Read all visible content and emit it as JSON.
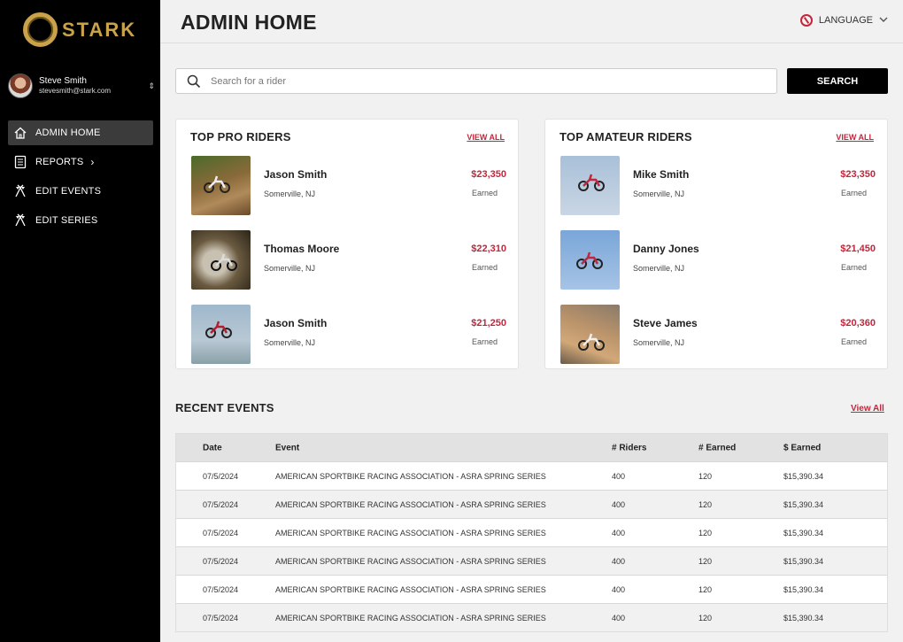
{
  "brand": {
    "name": "STARK"
  },
  "user": {
    "name": "Steve Smith",
    "email": "stevesmith@stark.com",
    "toggle_glyph": "⇕"
  },
  "nav": {
    "items": [
      {
        "label": "ADMIN HOME",
        "icon": "home-icon",
        "active": true
      },
      {
        "label": "REPORTS",
        "icon": "reports-icon",
        "chevron": "›"
      },
      {
        "label": "EDIT EVENTS",
        "icon": "flags-icon"
      },
      {
        "label": "EDIT SERIES",
        "icon": "flags-icon"
      }
    ]
  },
  "header": {
    "title": "ADMIN HOME",
    "language_label": "LANGUAGE",
    "language_chevron": "⌄"
  },
  "search": {
    "placeholder": "Search for a rider",
    "button_label": "SEARCH"
  },
  "pro": {
    "title": "TOP PRO RIDERS",
    "view_all": "VIEW ALL",
    "riders": [
      {
        "name": "Jason Smith",
        "location": "Somerville, NJ",
        "earned": "$23,350",
        "earned_label": "Earned"
      },
      {
        "name": "Thomas Moore",
        "location": "Somerville, NJ",
        "earned": "$22,310",
        "earned_label": "Earned"
      },
      {
        "name": "Jason Smith",
        "location": "Somerville, NJ",
        "earned": "$21,250",
        "earned_label": "Earned"
      }
    ]
  },
  "amateur": {
    "title": "TOP AMATEUR RIDERS",
    "view_all": "VIEW ALL",
    "riders": [
      {
        "name": "Mike Smith",
        "location": "Somerville, NJ",
        "earned": "$23,350",
        "earned_label": "Earned"
      },
      {
        "name": "Danny Jones",
        "location": "Somerville, NJ",
        "earned": "$21,450",
        "earned_label": "Earned"
      },
      {
        "name": "Steve James",
        "location": "Somerville, NJ",
        "earned": "$20,360",
        "earned_label": "Earned"
      }
    ]
  },
  "events": {
    "title": "RECENT EVENTS",
    "view_all": "View All",
    "columns": [
      "Date",
      "Event",
      "# Riders",
      "# Earned",
      "$ Earned"
    ],
    "rows": [
      [
        "07/5/2024",
        "AMERICAN SPORTBIKE RACING ASSOCIATION - ASRA SPRING SERIES",
        "400",
        "120",
        "$15,390.34"
      ],
      [
        "07/5/2024",
        "AMERICAN SPORTBIKE RACING ASSOCIATION - ASRA SPRING SERIES",
        "400",
        "120",
        "$15,390.34"
      ],
      [
        "07/5/2024",
        "AMERICAN SPORTBIKE RACING ASSOCIATION - ASRA SPRING SERIES",
        "400",
        "120",
        "$15,390.34"
      ],
      [
        "07/5/2024",
        "AMERICAN SPORTBIKE RACING ASSOCIATION - ASRA SPRING SERIES",
        "400",
        "120",
        "$15,390.34"
      ],
      [
        "07/5/2024",
        "AMERICAN SPORTBIKE RACING ASSOCIATION - ASRA SPRING SERIES",
        "400",
        "120",
        "$15,390.34"
      ],
      [
        "07/5/2024",
        "AMERICAN SPORTBIKE RACING ASSOCIATION - ASRA SPRING SERIES",
        "400",
        "120",
        "$15,390.34"
      ]
    ]
  },
  "colors": {
    "accent": "#c4253a",
    "sidebar": "#000000",
    "gold": "#c9a24a",
    "background": "#f1f1f1"
  }
}
